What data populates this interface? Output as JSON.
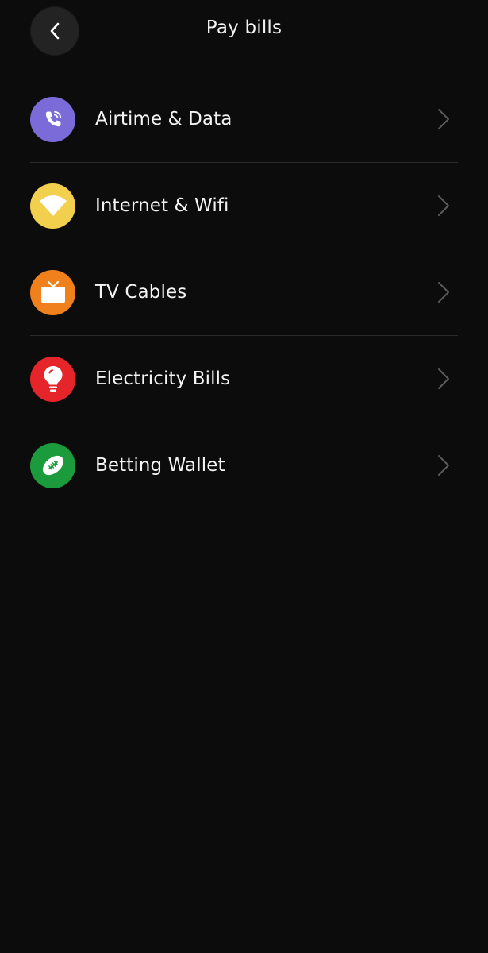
{
  "header": {
    "title": "Pay bills",
    "back_icon": "chevron-left-icon"
  },
  "items": [
    {
      "label": "Airtime & Data",
      "icon": "phone-call-icon",
      "color": "#7b6bd8"
    },
    {
      "label": "Internet & Wifi",
      "icon": "wifi-icon",
      "color": "#f3cf4e"
    },
    {
      "label": "TV Cables",
      "icon": "tv-icon",
      "color": "#f0801c"
    },
    {
      "label": "Electricity Bills",
      "icon": "light-bulb-icon",
      "color": "#e5252a"
    },
    {
      "label": "Betting Wallet",
      "icon": "football-icon",
      "color": "#1c9b3c"
    }
  ],
  "colors": {
    "background": "#0c0c0c",
    "divider": "#2a2a2a",
    "chevron": "#5a5a5a"
  }
}
